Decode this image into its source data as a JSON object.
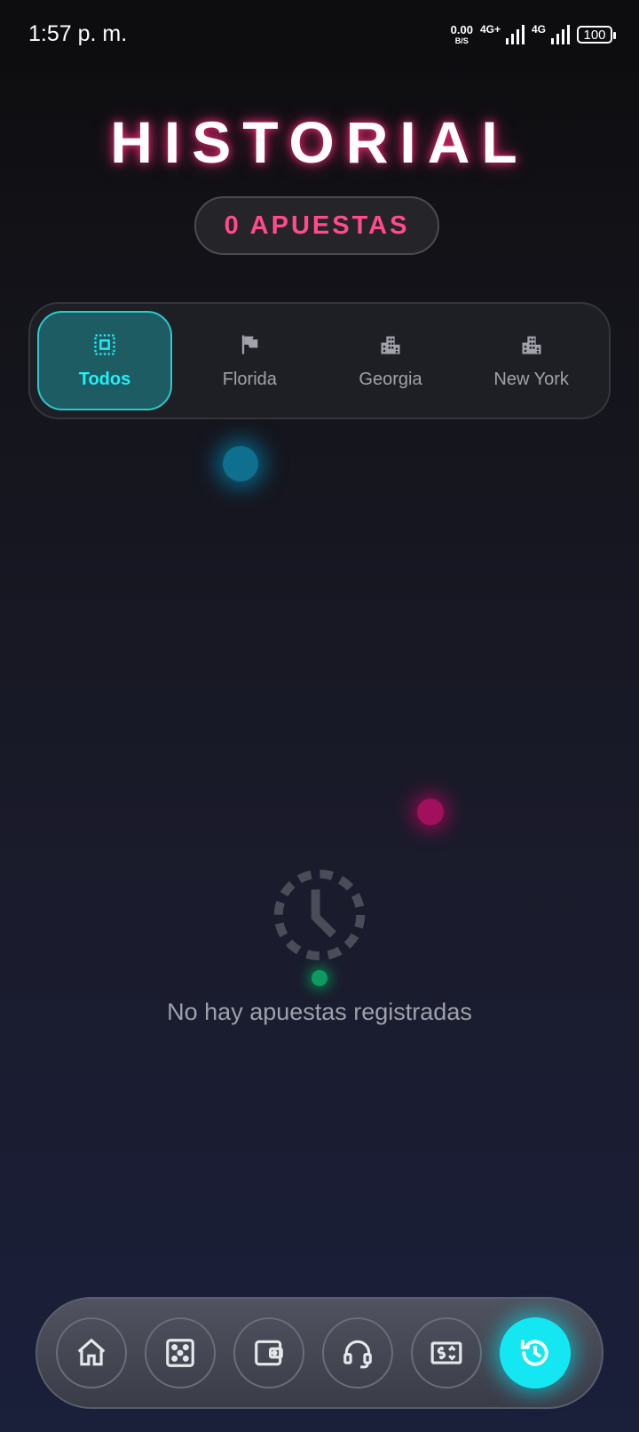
{
  "status_bar": {
    "time": "1:57 p. m.",
    "net_speed_value": "0.00",
    "net_speed_unit": "B/S",
    "sim1_label": "4G+",
    "sim2_label": "4G",
    "battery": "100"
  },
  "header": {
    "title": "HISTORIAL",
    "bets_count": "0 APUESTAS"
  },
  "filters": {
    "tabs": [
      {
        "label": "Todos",
        "icon": "select-all-icon",
        "active": true
      },
      {
        "label": "Florida",
        "icon": "flag-icon",
        "active": false
      },
      {
        "label": "Georgia",
        "icon": "city-icon",
        "active": false
      },
      {
        "label": "New York",
        "icon": "city-icon",
        "active": false
      }
    ]
  },
  "empty_state": {
    "icon": "clock-dashed-icon",
    "message": "No hay apuestas registradas"
  },
  "bottom_nav": {
    "items": [
      {
        "icon": "home-icon"
      },
      {
        "icon": "dice-icon"
      },
      {
        "icon": "wallet-icon"
      },
      {
        "icon": "headset-icon"
      },
      {
        "icon": "cash-icon"
      },
      {
        "icon": "history-icon",
        "active": true
      }
    ]
  },
  "colors": {
    "accent_cyan": "#15e7f2",
    "accent_pink": "#ff4b8b",
    "active_tab_bg": "#1d5c62"
  }
}
